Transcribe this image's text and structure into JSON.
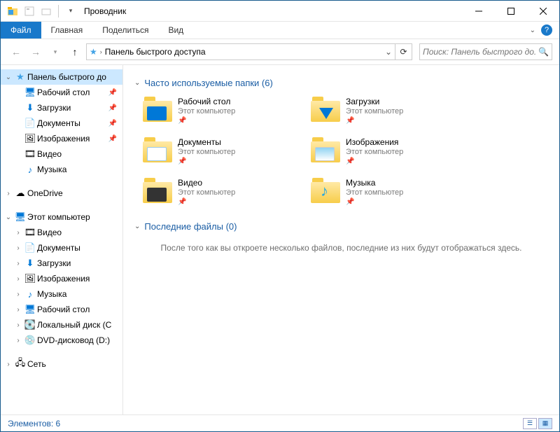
{
  "window_title": "Проводник",
  "ribbon": {
    "file": "Файл",
    "tabs": [
      "Главная",
      "Поделиться",
      "Вид"
    ]
  },
  "nav": {
    "address": "Панель быстрого доступа",
    "search_placeholder": "Поиск: Панель быстрого до..."
  },
  "tree": {
    "quick_access": "Панель быстрого до",
    "quick_items": [
      {
        "label": "Рабочий стол",
        "icon": "desktop",
        "pinned": true
      },
      {
        "label": "Загрузки",
        "icon": "downloads",
        "pinned": true
      },
      {
        "label": "Документы",
        "icon": "documents",
        "pinned": true
      },
      {
        "label": "Изображения",
        "icon": "pictures",
        "pinned": true
      },
      {
        "label": "Видео",
        "icon": "videos",
        "pinned": false
      },
      {
        "label": "Музыка",
        "icon": "music",
        "pinned": false
      }
    ],
    "onedrive": "OneDrive",
    "this_pc": "Этот компьютер",
    "pc_items": [
      {
        "label": "Видео",
        "icon": "videos"
      },
      {
        "label": "Документы",
        "icon": "documents"
      },
      {
        "label": "Загрузки",
        "icon": "downloads"
      },
      {
        "label": "Изображения",
        "icon": "pictures"
      },
      {
        "label": "Музыка",
        "icon": "music"
      },
      {
        "label": "Рабочий стол",
        "icon": "desktop"
      },
      {
        "label": "Локальный диск (C",
        "icon": "drive"
      },
      {
        "label": "DVD-дисковод (D:)",
        "icon": "dvd"
      }
    ],
    "network": "Сеть"
  },
  "content": {
    "group1_title": "Часто используемые папки (6)",
    "group2_title": "Последние файлы (0)",
    "subtitle": "Этот компьютер",
    "folders": [
      {
        "name": "Рабочий стол",
        "overlay": "ov-desktop"
      },
      {
        "name": "Загрузки",
        "overlay": "ov-down"
      },
      {
        "name": "Документы",
        "overlay": "ov-doc"
      },
      {
        "name": "Изображения",
        "overlay": "ov-img"
      },
      {
        "name": "Видео",
        "overlay": "ov-vid"
      },
      {
        "name": "Музыка",
        "overlay": "ov-music"
      }
    ],
    "empty_message": "После того как вы откроете несколько файлов, последние из них будут отображаться здесь."
  },
  "status": {
    "count_label": "Элементов: 6"
  }
}
